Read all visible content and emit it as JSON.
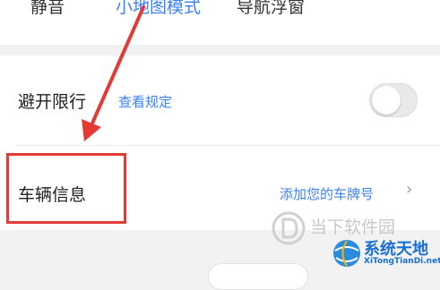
{
  "tabs": [
    {
      "label": "静音"
    },
    {
      "label": "小地图模式"
    },
    {
      "label": "导航浮窗"
    }
  ],
  "avoid_restriction": {
    "label": "避开限行",
    "link": "查看规定",
    "toggle_on": false
  },
  "vehicle_info": {
    "label": "车辆信息",
    "action": "添加您的车牌号",
    "chevron": "›"
  },
  "watermark": {
    "site_cn": "当下软件园",
    "brand": "系统天地",
    "url": "XiTongTianDi.net"
  },
  "colors": {
    "accent": "#3b82f6",
    "annotation": "#e53935",
    "watermark_blue": "#1a6fd6"
  }
}
